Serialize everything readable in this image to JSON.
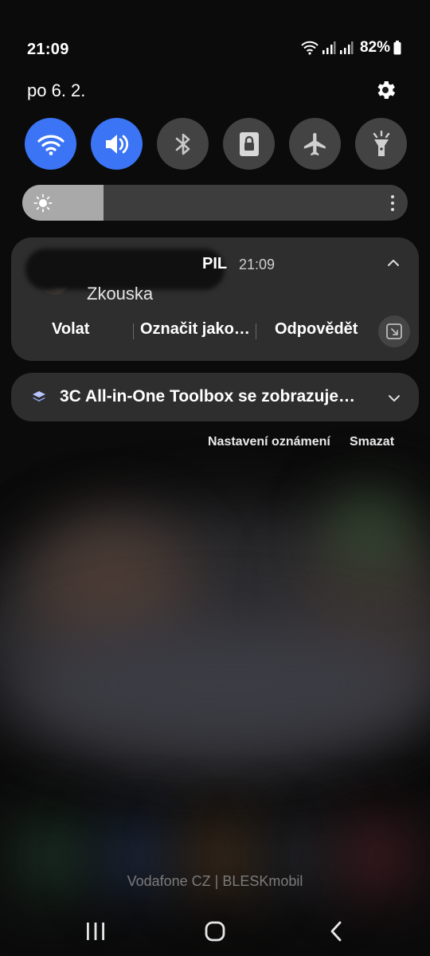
{
  "status_bar": {
    "time": "21:09",
    "battery": "82%",
    "icons": [
      "wifi-icon",
      "signal-icon",
      "signal-icon",
      "battery-icon"
    ]
  },
  "header": {
    "date": "po 6. 2.",
    "settings_icon": "gear-icon"
  },
  "quick_settings": [
    {
      "name": "wifi",
      "icon": "wifi-icon",
      "active": true
    },
    {
      "name": "sound",
      "icon": "volume-icon",
      "active": true
    },
    {
      "name": "bluetooth",
      "icon": "bluetooth-icon",
      "active": false
    },
    {
      "name": "screen-rotation-lock",
      "icon": "rotation-lock-icon",
      "active": false
    },
    {
      "name": "airplane-mode",
      "icon": "airplane-icon",
      "active": false
    },
    {
      "name": "flashlight",
      "icon": "flashlight-icon",
      "active": false
    }
  ],
  "brightness": {
    "level": 0.21
  },
  "notification_message": {
    "sender": "PIL",
    "time": "21:09",
    "message": "Zkouska",
    "actions": [
      "Volat",
      "Označit jako…",
      "Odpovědět"
    ]
  },
  "notification_app": {
    "title": "3C All-in-One Toolbox se zobrazuje…"
  },
  "footer_links": {
    "settings": "Nastavení oznámení",
    "clear": "Smazat"
  },
  "carrier": "Vodafone CZ | BLESKmobil",
  "colors": {
    "accent": "#3b74f4",
    "tile_off": "#434343",
    "card": "#2e2e2e"
  }
}
